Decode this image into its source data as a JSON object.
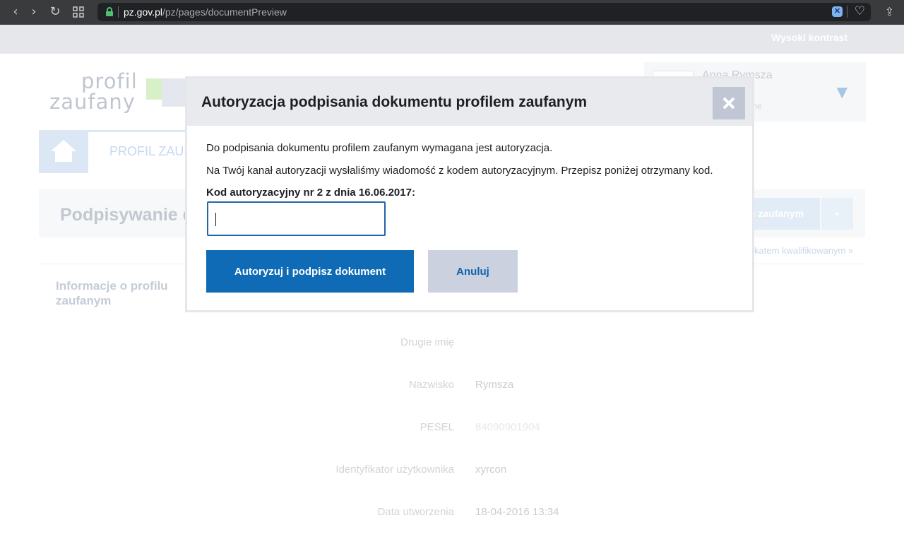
{
  "browser": {
    "url_host": "pz.gov.pl",
    "url_path": "/pz/pages/documentPreview",
    "back_icon": "‹",
    "forward_icon": "›",
    "reload_icon": "↻",
    "heart_icon": "♡",
    "share_icon": "⇪",
    "ext_icon": "✕"
  },
  "header": {
    "contrast_label": "Wysoki kontrast",
    "logo_line1": "profil",
    "logo_line2": "zaufany",
    "user_name": "Anna Rymsza",
    "user_sub": "tne",
    "chevron": "▼"
  },
  "nav": {
    "tab_label": "PROFIL ZAUF"
  },
  "page": {
    "title": "Podpisywanie d",
    "sign_button_label": "n zaufanym",
    "sign_arrow": "▸",
    "cert_link": "katem kwalifikowanym »",
    "info_header": "Informacje o profilu zaufanym"
  },
  "info_rows": [
    {
      "label": "Drugie imię",
      "value": ""
    },
    {
      "label": "Nazwisko",
      "value": "Rymsza"
    },
    {
      "label": "PESEL",
      "value": "84090901904"
    },
    {
      "label": "Identyfikator użytkownika",
      "value": "xyrcon"
    },
    {
      "label": "Data utworzenia",
      "value": "18-04-2016 13:34"
    }
  ],
  "modal": {
    "title": "Autoryzacja podpisania dokumentu profilem zaufanym",
    "text1": "Do podpisania dokumentu profilem zaufanym wymagana jest autoryzacja.",
    "text2": "Na Twój kanał autoryzacji wysłaliśmy wiadomość z kodem autoryzacyjnym. Przepisz poniżej otrzymany kod.",
    "code_label": "Kod autoryzacyjny nr 2 z dnia 16.06.2017:",
    "code_value": "",
    "primary_button": "Autoryzuj i podpisz dokument",
    "secondary_button": "Anuluj"
  },
  "colors": {
    "primary": "#0f6bb5",
    "secondary": "#cbd1df",
    "close_bg": "#c1c6d4"
  }
}
